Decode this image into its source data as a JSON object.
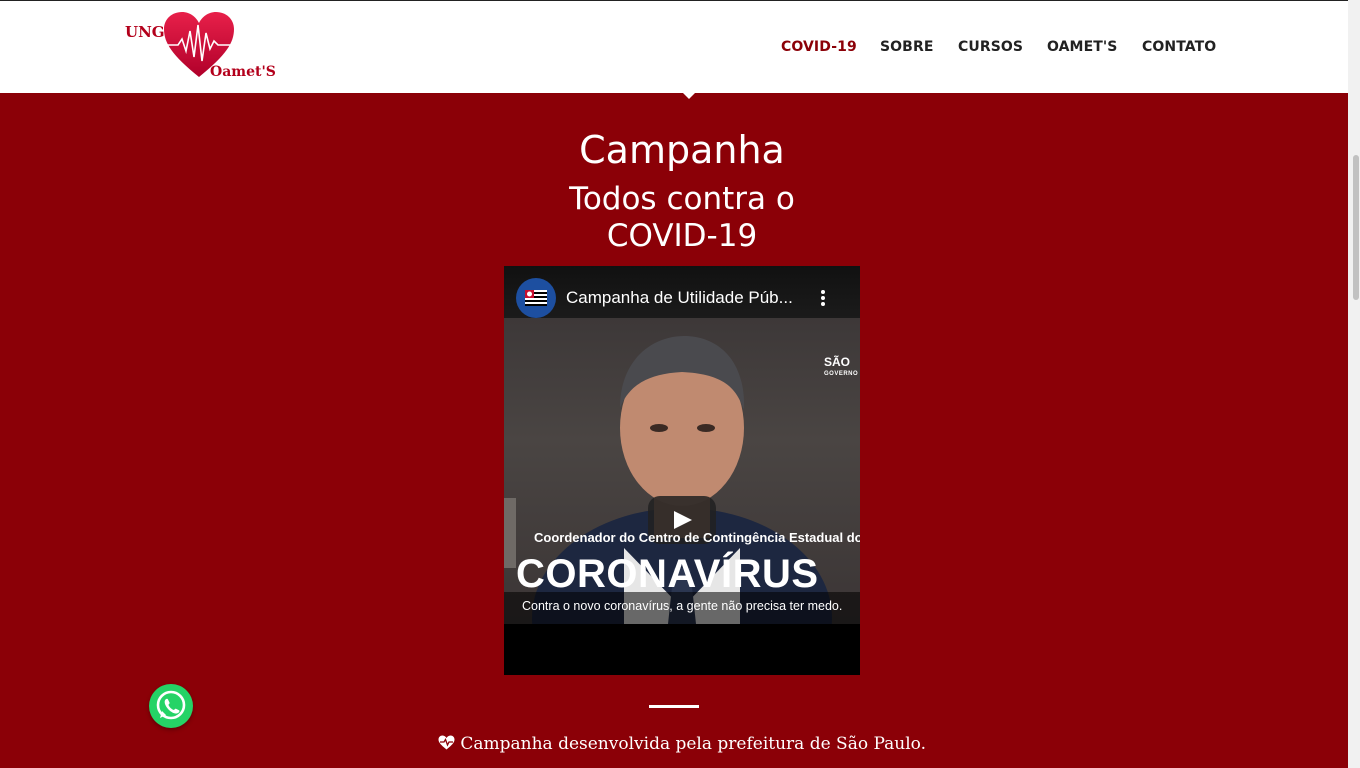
{
  "header": {
    "logo": {
      "text_left": "UNG",
      "text_right": "Oamet'S"
    },
    "nav": [
      {
        "label": "COVID-19",
        "active": true
      },
      {
        "label": "SOBRE",
        "active": false
      },
      {
        "label": "CURSOS",
        "active": false
      },
      {
        "label": "OAMET'S",
        "active": false
      },
      {
        "label": "CONTATO",
        "active": false
      }
    ]
  },
  "main": {
    "title": "Campanha",
    "subtitle": "Todos contra o COVID-19",
    "video": {
      "title": "Campanha de Utilidade Púb...",
      "brand": "SÃO",
      "brand_sub": "GOVERNO",
      "lower_third": "Coordenador do Centro de Contingência Estadual do",
      "big_word": "CORONAVÍRUS",
      "caption": "Contra o novo coronavírus, a gente não precisa ter medo."
    },
    "footnote": "Campanha desenvolvida pela prefeitura de São Paulo."
  },
  "colors": {
    "background": "#8b0007",
    "nav_active": "#8b0007",
    "nav_text": "#222222",
    "whatsapp": "#25d366"
  },
  "icons": [
    "heartbeat-logo-icon",
    "play-icon",
    "more-options-icon",
    "heart-pulse-icon",
    "whatsapp-icon"
  ]
}
